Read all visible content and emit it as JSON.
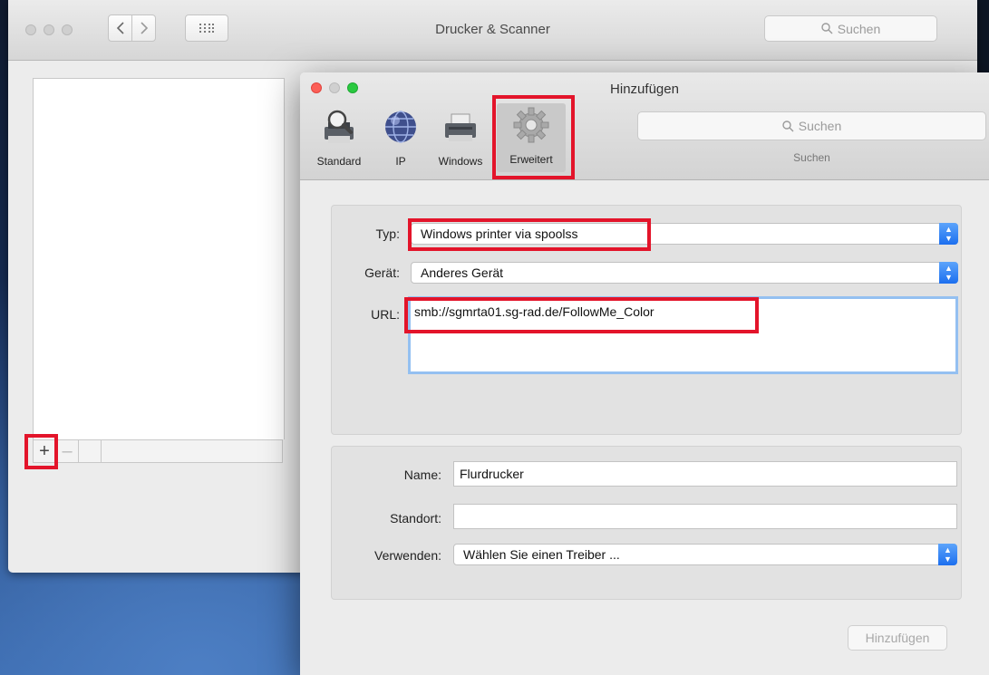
{
  "main_window": {
    "title": "Drucker & Scanner",
    "search_placeholder": "Suchen",
    "add_symbol": "+",
    "remove_symbol": "–",
    "nav_back_icon": "chevron-left-icon",
    "nav_forward_icon": "chevron-right-icon",
    "grid_icon": "show-all-grid-icon"
  },
  "sheet": {
    "title": "Hinzufügen",
    "toolbar": [
      {
        "label": "Standard",
        "icon": "default-printer-icon"
      },
      {
        "label": "IP",
        "icon": "globe-icon"
      },
      {
        "label": "Windows",
        "icon": "windows-printer-icon"
      },
      {
        "label": "Erweitert",
        "icon": "gear-icon",
        "selected": true
      }
    ],
    "search_placeholder": "Suchen",
    "search_caption": "Suchen",
    "form": {
      "typ_label": "Typ:",
      "typ_value": "Windows printer via spoolss",
      "geraet_label": "Gerät:",
      "geraet_value": "Anderes Gerät",
      "url_label": "URL:",
      "url_value": "smb://sgmrta01.sg-rad.de/FollowMe_Color"
    },
    "details": {
      "name_label": "Name:",
      "name_value": "Flurdrucker",
      "standort_label": "Standort:",
      "standort_value": "",
      "verwenden_label": "Verwenden:",
      "verwenden_value": "Wählen Sie einen Treiber ..."
    },
    "add_button_label": "Hinzufügen"
  },
  "colors": {
    "highlight": "#e3142a",
    "accent_blue": "#1c6fef",
    "window_bg": "#ececec"
  }
}
